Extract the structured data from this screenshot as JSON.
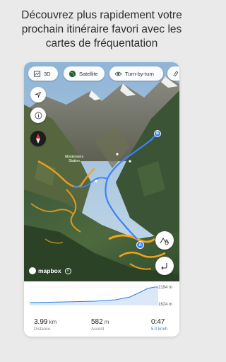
{
  "headline": {
    "line1": "Découvrez plus rapidement votre",
    "line2": "prochain itinéraire favori avec les",
    "line3": "cartes de fréquentation"
  },
  "toolbar": {
    "mode_3d_label": "3D",
    "satellite_label": "Satellite",
    "turn_by_turn_label": "Turn-by-turn"
  },
  "map": {
    "place_label_1": "Montenvers",
    "place_label_2": "Station",
    "marker_a": "A",
    "marker_b": "B",
    "attribution": "mapbox"
  },
  "elevation": {
    "max": "2194 m",
    "min": "1624 m"
  },
  "stats": {
    "distance_value": "3.99",
    "distance_unit": "km",
    "distance_label": "Distance",
    "ascent_value": "582",
    "ascent_unit": "m",
    "ascent_label": "Ascent",
    "time_value": "0:47",
    "time_speed": "5.0 km/h"
  },
  "colors": {
    "route_blue": "#3b82f6",
    "heat_orange": "#f5a31a",
    "accent_blue": "#2f7de1"
  }
}
